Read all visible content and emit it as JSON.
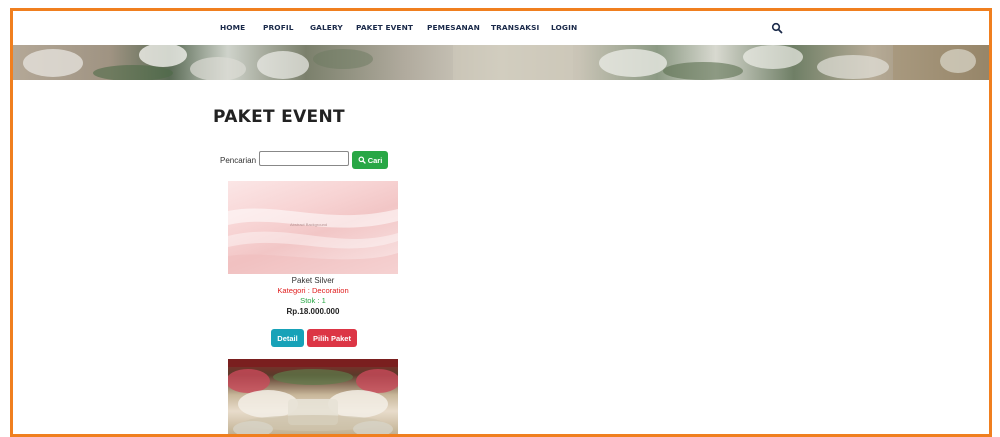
{
  "nav": {
    "items": [
      "HOME",
      "PROFIL",
      "GALERY",
      "PAKET EVENT",
      "PEMESANAN",
      "TRANSAKSI",
      "LOGIN"
    ],
    "search_icon": "search-icon"
  },
  "page": {
    "title": "PAKET EVENT"
  },
  "search": {
    "label": "Pencarian :",
    "value": "",
    "placeholder": "",
    "button_label": "Cari",
    "button_icon": "search-icon"
  },
  "products": [
    {
      "image_text": "Abstract Background",
      "name": "Paket Silver",
      "category": "Kategori : Decoration",
      "stock": "Stok : 1",
      "price": "Rp.18.000.000",
      "detail_label": "Detail",
      "select_label": "Pilih Paket"
    }
  ],
  "colors": {
    "frame": "#f07f1f",
    "nav_text": "#1b2a4a",
    "btn_cari": "#28a745",
    "btn_detail": "#17a2b8",
    "btn_pilih": "#dc3545",
    "category": "#e02020",
    "stock": "#28a745"
  }
}
